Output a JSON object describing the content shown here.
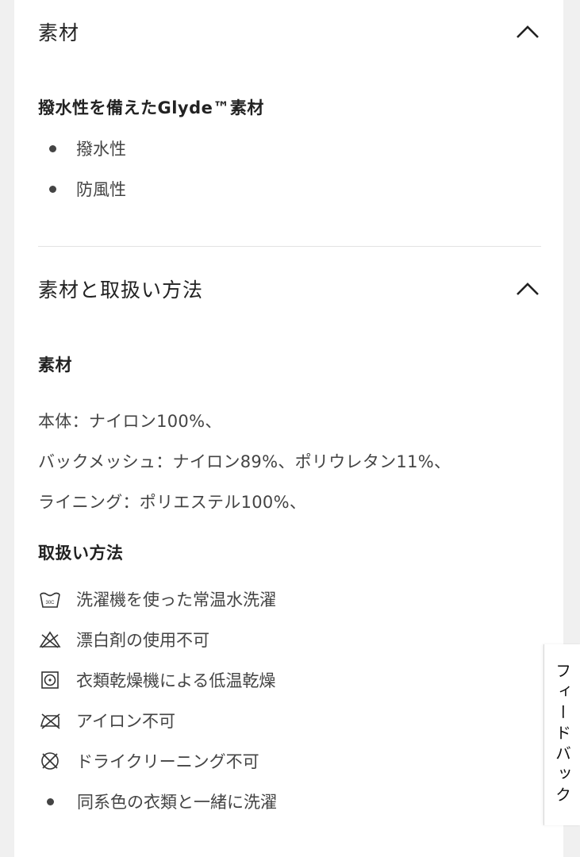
{
  "sections": [
    {
      "title": "素材",
      "subheading": "撥水性を備えたGlyde™素材",
      "features": [
        "撥水性",
        "防風性"
      ]
    },
    {
      "title": "素材と取扱い方法",
      "material_heading": "素材",
      "material_lines": [
        "本体：ナイロン100%、",
        "バックメッシュ：ナイロン89%、ポリウレタン11%、",
        "ライニング：ポリエステル100%、"
      ],
      "care_heading": "取扱い方法",
      "care_items": [
        {
          "icon": "wash-30c-icon",
          "label": "洗濯機を使った常温水洗濯"
        },
        {
          "icon": "no-bleach-icon",
          "label": "漂白剤の使用不可"
        },
        {
          "icon": "tumble-dry-low-icon",
          "label": "衣類乾燥機による低温乾燥"
        },
        {
          "icon": "no-iron-icon",
          "label": "アイロン不可"
        },
        {
          "icon": "no-dry-clean-icon",
          "label": "ドライクリーニング不可"
        },
        {
          "icon": "bullet",
          "label": "同系色の衣類と一緒に洗濯"
        }
      ]
    }
  ],
  "wash_temp_label": "30C",
  "feedback_label": "フィードバック"
}
